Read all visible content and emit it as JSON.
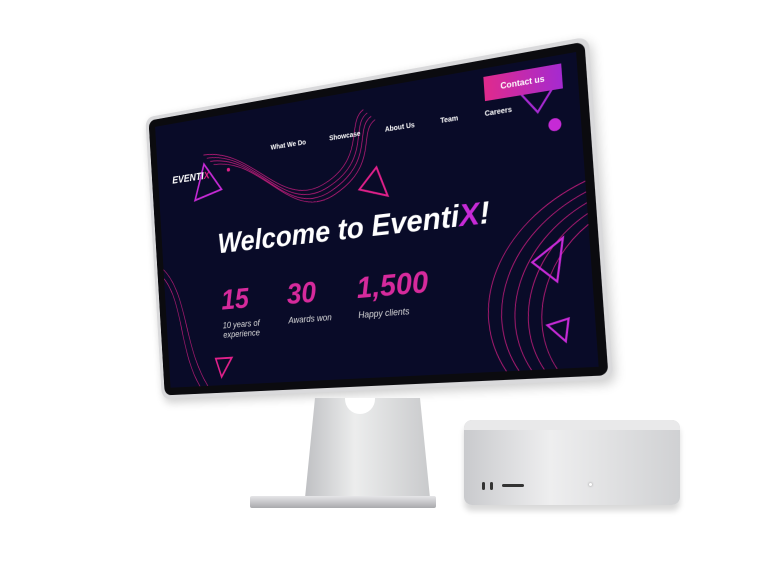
{
  "site": {
    "logo": {
      "main": "EVENTI",
      "accent": "X"
    },
    "nav": [
      "What We Do",
      "Showcase",
      "About Us",
      "Team",
      "Careers"
    ],
    "contact_button": "Contact us",
    "hero": {
      "title_main": "Welcome to Eventi",
      "title_accent": "X",
      "title_end": "!"
    },
    "stats": [
      {
        "value": "15",
        "label": "10 years of experience"
      },
      {
        "value": "30",
        "label": "Awards won"
      },
      {
        "value": "1,500",
        "label": "Happy clients"
      }
    ]
  },
  "colors": {
    "background": "#090b28",
    "accent": "#e0208a",
    "accent2": "#a52ad0"
  }
}
